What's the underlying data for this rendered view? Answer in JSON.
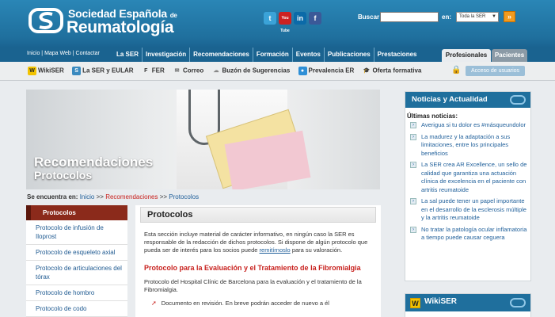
{
  "header": {
    "logo_line1": "Sociedad Española",
    "logo_line1_suffix": "de",
    "logo_line2": "Reumatología",
    "social": [
      {
        "name": "twitter-icon",
        "glyph": "t"
      },
      {
        "name": "youtube-icon",
        "glyph": "You Tube"
      },
      {
        "name": "linkedin-icon",
        "glyph": "in"
      },
      {
        "name": "facebook-icon",
        "glyph": "f"
      }
    ],
    "search_label": "Buscar",
    "search_value": "",
    "scope_label": "en:",
    "scope_selected": "Toda la SER",
    "search_go": "»"
  },
  "nav": {
    "utility": [
      "Inicio",
      "Mapa Web",
      "Contactar"
    ],
    "main": [
      "La SER",
      "Investigación",
      "Recomendaciones",
      "Formación",
      "Eventos",
      "Publicaciones",
      "Prestaciones"
    ],
    "tab_active": "Profesionales",
    "tab_inactive": "Pacientes"
  },
  "toolbar": {
    "items": [
      {
        "label": "WikiSER",
        "icon": "wikiser-icon",
        "glyph": "W"
      },
      {
        "label": "La SER y EULAR",
        "icon": "ser-eular-icon",
        "glyph": "S"
      },
      {
        "label": "FER",
        "icon": "fer-icon",
        "glyph": "F"
      },
      {
        "label": "Correo",
        "icon": "mail-icon",
        "glyph": "✉"
      },
      {
        "label": "Buzón de Sugerencias",
        "icon": "mailbox-icon",
        "glyph": "☁"
      },
      {
        "label": "Prevalencia ER",
        "icon": "prevalence-icon",
        "glyph": "●"
      },
      {
        "label": "Oferta formativa",
        "icon": "graduation-cap-icon",
        "glyph": "🎓"
      }
    ],
    "access_label": "Acceso de usuarios"
  },
  "hero": {
    "title": "Recomendaciones",
    "subtitle": "Protocolos"
  },
  "breadcrumb": {
    "label": "Se encuentra en:",
    "home": "Inicio",
    "sep": ">>",
    "section": "Recomendaciones",
    "current": "Protocolos"
  },
  "sidebar": {
    "title": "Protocolos",
    "items": [
      "Protocolo de infusión de Iloprost",
      "Protocolo de esqueleto axial",
      "Protocolo de articulaciones del tórax",
      "Protocolo de hombro",
      "Protocolo de codo"
    ]
  },
  "content": {
    "title": "Protocolos",
    "intro_a": "Esta sección incluye material de carácter informativo, en ningún caso la SER es responsable de la redacción de dichos protocolos. Si dispone de algún protocolo que pueda ser de interés para los socios puede",
    "intro_link": "remitírnoslo",
    "intro_b": "para su valoración.",
    "section_title": "Protocolo para la Evaluación y el Tratamiento de la Fibromialgia",
    "section_text": "Protocolo del Hospital Clínic de Barcelona para la evaluación y el tratamiento de la Fibromialgia.",
    "bullet": "Documento en revisión. En breve podrán acceder de nuevo a él"
  },
  "news": {
    "title": "Noticias y Actualidad",
    "subtitle": "Últimas noticias:",
    "items": [
      "Averigua si tu dolor es #másqueundolor",
      "La madurez y la adaptación a sus limitaciones, entre los principales beneficios",
      "La SER crea AR Excellence, un sello de calidad que garantiza una actuación clínica de excelencia en el paciente con artritis reumatoide",
      "La sal puede tener un papel importante en el desarrollo de la esclerosis múltiple y la artritis reumatoide",
      "No tratar la patología ocular inflamatoria a tiempo puede causar ceguera"
    ]
  },
  "wikiser": {
    "glyph": "W",
    "title": "WikiSER"
  }
}
